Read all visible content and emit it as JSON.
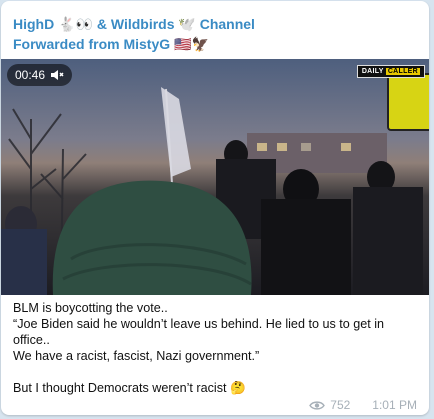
{
  "header": {
    "channel_name": "HighD 🐇👀 & Wildbirds 🕊️ Channel",
    "forwarded_from": "Forwarded from MistyG 🇺🇸🦅"
  },
  "video": {
    "duration": "00:46",
    "mute_icon": "speaker-muted-icon",
    "watermark_left": "DAILY",
    "watermark_right": "CALLER"
  },
  "message": {
    "lines": [
      "BLM is boycotting the vote..",
      "“Joe Biden said he wouldn’t leave us behind. He lied to us to get in",
      "office..",
      "We have a racist, fascist, Nazi government.”",
      "",
      "But I thought Democrats weren’t racist 🤔"
    ]
  },
  "meta": {
    "views": "752",
    "time": "1:01 PM",
    "views_icon": "eye-icon"
  }
}
